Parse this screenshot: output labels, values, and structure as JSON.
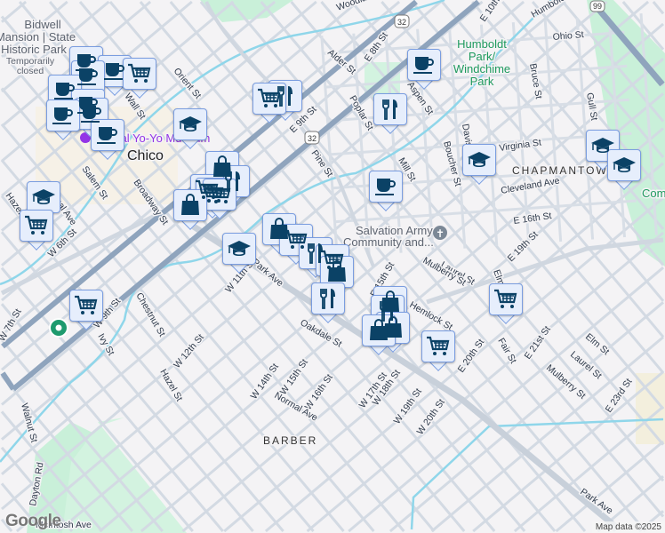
{
  "map": {
    "attribution": "Map data ©2025",
    "logo": "Google",
    "city": "Chico",
    "neighborhoods": [
      "CHAPMANTOWN",
      "BARBER"
    ],
    "pois": {
      "bidwell": [
        "Bidwell",
        "Mansion | State",
        "Historic Park"
      ],
      "bidwell_status": [
        "Temporarily",
        "closed"
      ],
      "museum": "National Yo-Yo Museum",
      "humboldt_park": [
        "Humboldt",
        "Park/",
        "Windchime",
        "Park"
      ],
      "salvation": [
        "Salvation Army",
        "Community and..."
      ],
      "community_park": "Com"
    },
    "highway_shields": [
      "32",
      "32",
      "99"
    ],
    "streets": [
      "Woodland Ave",
      "E 10th St",
      "Humboldt Ave",
      "Ohio St",
      "Alder St",
      "E 8th St",
      "E 9th St",
      "Aspen St",
      "Orient St",
      "Wall St",
      "Broadway St",
      "Salem St",
      "Normal Ave",
      "Hazel St",
      "W 6th St",
      "Bruce St",
      "Gull St",
      "Poplar St",
      "Pine St",
      "Mill St",
      "Davis St",
      "Virginia St",
      "Boucher St",
      "Cleveland Ave",
      "E 16th St",
      "Laurel St",
      "Mulberry St",
      "Elm St",
      "E 19th St",
      "W 11th St",
      "Park Ave",
      "W 9th St",
      "Chestnut St",
      "Ivy St",
      "W 12th St",
      "Hazel St",
      "Oakdale St",
      "W 14th St",
      "W 15th St",
      "W 16th St",
      "Normal Ave",
      "W 17th St",
      "W 18th St",
      "W 19th St",
      "W 20th St",
      "E 20th St",
      "Hemlock St",
      "Fair St",
      "E 21st St",
      "Elm St",
      "Laurel St",
      "Mulberry St",
      "E 23rd St",
      "Park Ave",
      "Walnut St",
      "Dayton Rd",
      "McIntosh Ave",
      "E 15th St",
      "W 7th St"
    ]
  },
  "markers": {
    "legend": [
      "coffee-cup",
      "shopping-cart",
      "fork-knife",
      "graduation-cap",
      "shopping-bag"
    ]
  },
  "colors": {
    "marker_fill": "#e6eefc",
    "marker_border": "#7a9de0",
    "icon": "#0b4266",
    "water": "#8fd6ea",
    "park": "#c9f0d9",
    "highway": "#8fa4bd"
  }
}
